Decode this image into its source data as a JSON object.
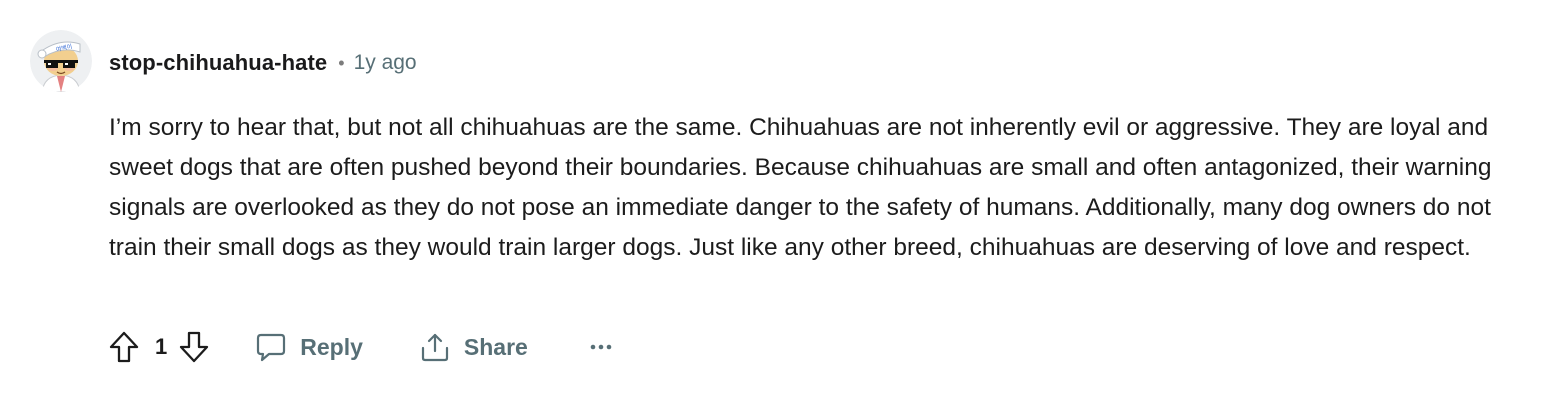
{
  "comment": {
    "author": "stop-chihuahua-hate",
    "separator": "•",
    "timestamp": "1y ago",
    "body": "I’m sorry to hear that, but not all chihuahuas are the same. Chihuahuas are not inherently evil or aggressive. They are loyal and sweet dogs that are often pushed beyond their boundaries. Because chihuahuas are small and often antagonized, their warning signals are overlooked as they do not pose an immediate danger to the safety of humans. Additionally, many dog owners do not train their small dogs as they would train larger dogs. Just like any other breed, chihuahuas are deserving of love and respect.",
    "avatar_headband_text": "여백이",
    "score": "1"
  },
  "actions": {
    "reply_label": "Reply",
    "share_label": "Share",
    "more_label": "···"
  },
  "icons": {
    "upvote": "arrow-up-outline-icon",
    "downvote": "arrow-down-outline-icon",
    "reply": "speech-bubble-icon",
    "share": "share-upload-icon",
    "more": "ellipsis-icon"
  },
  "colors": {
    "text": "#1c1c1c",
    "muted": "#576f76",
    "background": "#ffffff"
  }
}
